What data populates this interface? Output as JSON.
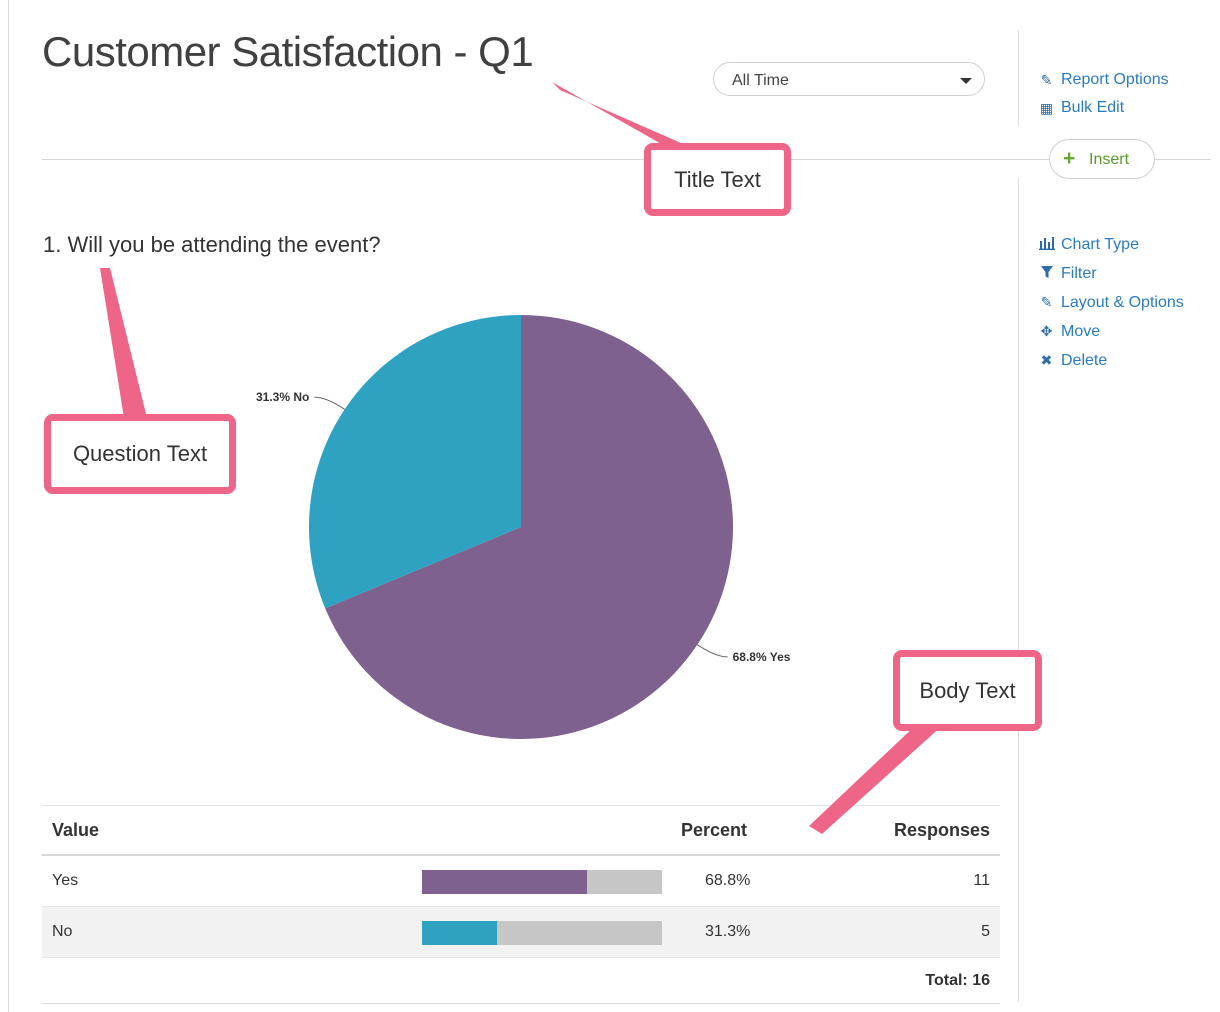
{
  "report": {
    "title": "Customer Satisfaction - Q1"
  },
  "filters": {
    "date_range": "All Time"
  },
  "report_actions": [
    {
      "label": "Report Options",
      "icon": "pencil-icon"
    },
    {
      "label": "Bulk Edit",
      "icon": "table-icon"
    }
  ],
  "insert": {
    "label": "Insert"
  },
  "chart_actions": [
    {
      "label": "Chart Type",
      "icon": "bar-chart-icon"
    },
    {
      "label": "Filter",
      "icon": "funnel-icon"
    },
    {
      "label": "Layout & Options",
      "icon": "pencil-icon"
    },
    {
      "label": "Move",
      "icon": "move-arrows-icon"
    },
    {
      "label": "Delete",
      "icon": "close-icon"
    }
  ],
  "question": {
    "text": "1. Will you be attending the event?"
  },
  "chart_data": {
    "type": "pie",
    "slices": [
      {
        "label": "68.8% Yes",
        "name": "Yes",
        "value": 68.8,
        "color": "#7e618e"
      },
      {
        "label": "31.3% No",
        "name": "No",
        "value": 31.3,
        "color": "#2fa2c2"
      }
    ]
  },
  "table": {
    "headers": {
      "value": "Value",
      "percent": "Percent",
      "responses": "Responses"
    },
    "rows": [
      {
        "value": "Yes",
        "percent": "68.8%",
        "fraction": 0.688,
        "responses": "11",
        "color": "#7e618e"
      },
      {
        "value": "No",
        "percent": "31.3%",
        "fraction": 0.313,
        "responses": "5",
        "color": "#2fa2c2"
      }
    ],
    "total": "Total: 16"
  },
  "annotations": {
    "title_text": "Title Text",
    "question_text": "Question Text",
    "body_text": "Body Text",
    "color": "#ee6587"
  }
}
